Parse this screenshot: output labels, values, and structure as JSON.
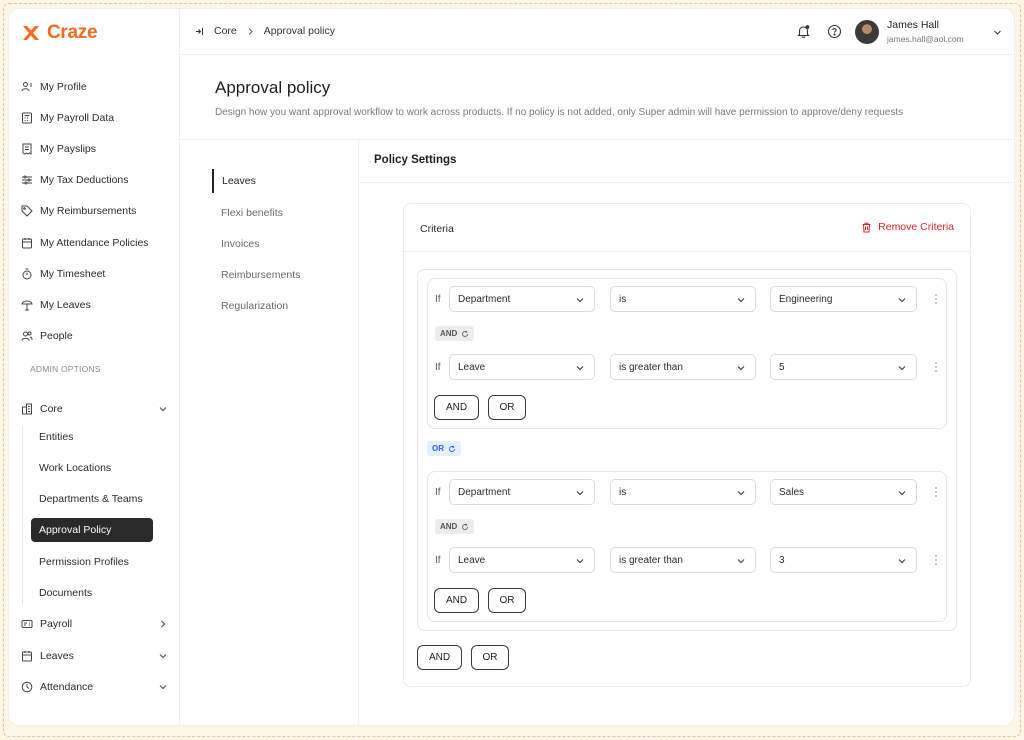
{
  "brand": {
    "name": "Craze",
    "accent": "#f26b1d"
  },
  "sidebar": {
    "items": [
      {
        "label": "My Profile",
        "icon": "user-list-icon"
      },
      {
        "label": "My Payroll Data",
        "icon": "calculator-icon"
      },
      {
        "label": "My Payslips",
        "icon": "receipt-icon"
      },
      {
        "label": "My Tax Deductions",
        "icon": "sliders-icon"
      },
      {
        "label": "My Reimbursements",
        "icon": "tag-icon"
      },
      {
        "label": "My Attendance Policies",
        "icon": "calendar-icon"
      },
      {
        "label": "My Timesheet",
        "icon": "stopwatch-icon"
      },
      {
        "label": "My Leaves",
        "icon": "umbrella-icon"
      },
      {
        "label": "People",
        "icon": "people-icon"
      }
    ],
    "admin_label": "ADMIN OPTIONS",
    "core": {
      "label": "Core",
      "icon": "building-icon"
    },
    "core_items": [
      "Entities",
      "Work Locations",
      "Departments & Teams",
      "Approval Policy",
      "Permission Profiles",
      "Documents"
    ],
    "active_core_item": "Approval Policy",
    "bottom_items": [
      {
        "label": "Payroll",
        "icon": "payroll-icon",
        "chevron": "right"
      },
      {
        "label": "Leaves",
        "icon": "calendar-icon",
        "chevron": "down"
      },
      {
        "label": "Attendance",
        "icon": "clock-icon",
        "chevron": "down"
      }
    ]
  },
  "topbar": {
    "breadcrumb": [
      "Core",
      "Approval policy"
    ],
    "user": {
      "name": "James Hall",
      "email": "james.hall@aol.com"
    }
  },
  "page": {
    "title": "Approval policy",
    "description": "Design how you want approval workflow to work across products. If no policy is not added, only Super admin will have permission to approve/deny requests"
  },
  "tabs": [
    "Leaves",
    "Flexi benefits",
    "Invoices",
    "Reimbursements",
    "Regularization"
  ],
  "active_tab": "Leaves",
  "policy": {
    "title": "Policy Settings",
    "criteria_title": "Criteria",
    "remove_label": "Remove Criteria",
    "if_label": "If",
    "groups": [
      {
        "conditions": [
          {
            "field": "Department",
            "operator": "is",
            "value": "Engineering"
          },
          {
            "field": "Leave",
            "operator": "is greater than",
            "value": "5"
          }
        ],
        "join": "AND"
      },
      {
        "conditions": [
          {
            "field": "Department",
            "operator": "is",
            "value": "Sales"
          },
          {
            "field": "Leave",
            "operator": "is greater than",
            "value": "3"
          }
        ],
        "join": "AND"
      }
    ],
    "group_join": "OR",
    "and_label": "AND",
    "or_label": "OR"
  },
  "colors": {
    "danger": "#dc2626",
    "or_chip": "#2563eb"
  }
}
